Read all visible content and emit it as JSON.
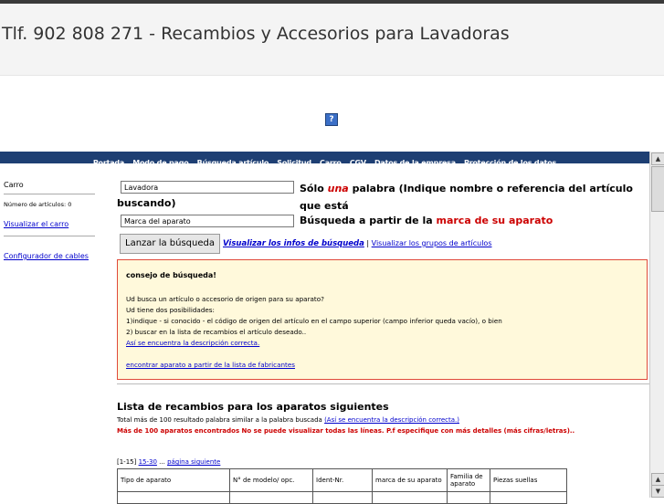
{
  "header": {
    "title": "Tlf. 902 808 271 - Recambios y Accesorios para Lavadoras"
  },
  "help_icon": "?",
  "nav": {
    "items": [
      "Portada",
      "Modo de pago",
      "Búsqueda artículo",
      "Solicitud",
      "Carro",
      "CGV",
      "Datos de la empresa",
      "Protección de los datos"
    ]
  },
  "sidebar": {
    "carro": "Carro",
    "num_articulos": "Número de artículos: 0",
    "ver_carro": "Visualizar el carro",
    "configurador": "Configurador de cables"
  },
  "search": {
    "field1_value": "Lavadora",
    "hint1_pre": "Sólo ",
    "hint1_red": "una",
    "hint1_post": " palabra (Indique nombre o referencia del artículo que está",
    "hint1_cont": "buscando)",
    "field2_value": "Marca del aparato",
    "hint2_pre": "Búsqueda a partir de la ",
    "hint2_red": "marca de su aparato",
    "button": "Lanzar la búsqueda",
    "link_infos": "Visualizar los infos de búsqueda",
    "link_sep": " | ",
    "link_grupos": "Visualizar los grupos de artículos"
  },
  "tip": {
    "title": "consejo de búsqueda!",
    "line1": "Ud busca un artículo o accesorio de origen para su aparato?",
    "line2": "Ud tiene dos posibilidades:",
    "line3": "1)indique - si conocido - el código de origen del artículo en el campo superior (campo inferior queda vacío), o bien",
    "line4": "2) buscar en la lista de recambios el artículo deseado..",
    "link1": "Así se encuentra la descripción correcta.",
    "link2": "encontrar aparato a partir de la lista de fabricantes"
  },
  "results": {
    "title": "Lista de recambios para los aparatos siguientes",
    "summary": "Total más de 100 resultado palabra similar a la palabra buscada",
    "summary_link": "(Así se encuentra la descripción correcta.)",
    "warning": "Más de 100 aparatos encontrados No se puede visualizar todas las líneas. P.f especifique con más detalles (más cifras/letras)..",
    "pager_prefix": "[1-15] ",
    "pager_next_range": "15-30",
    "pager_dots": " ... ",
    "pager_next": "página siguiente",
    "columns": [
      "Tipo de aparato",
      "N° de modelo/ opc.",
      "Ident-Nr.",
      "marca de su aparato",
      "Familia de aparato",
      "Piezas suellas"
    ]
  },
  "scroll": {
    "up": "▲",
    "down": "▼"
  }
}
